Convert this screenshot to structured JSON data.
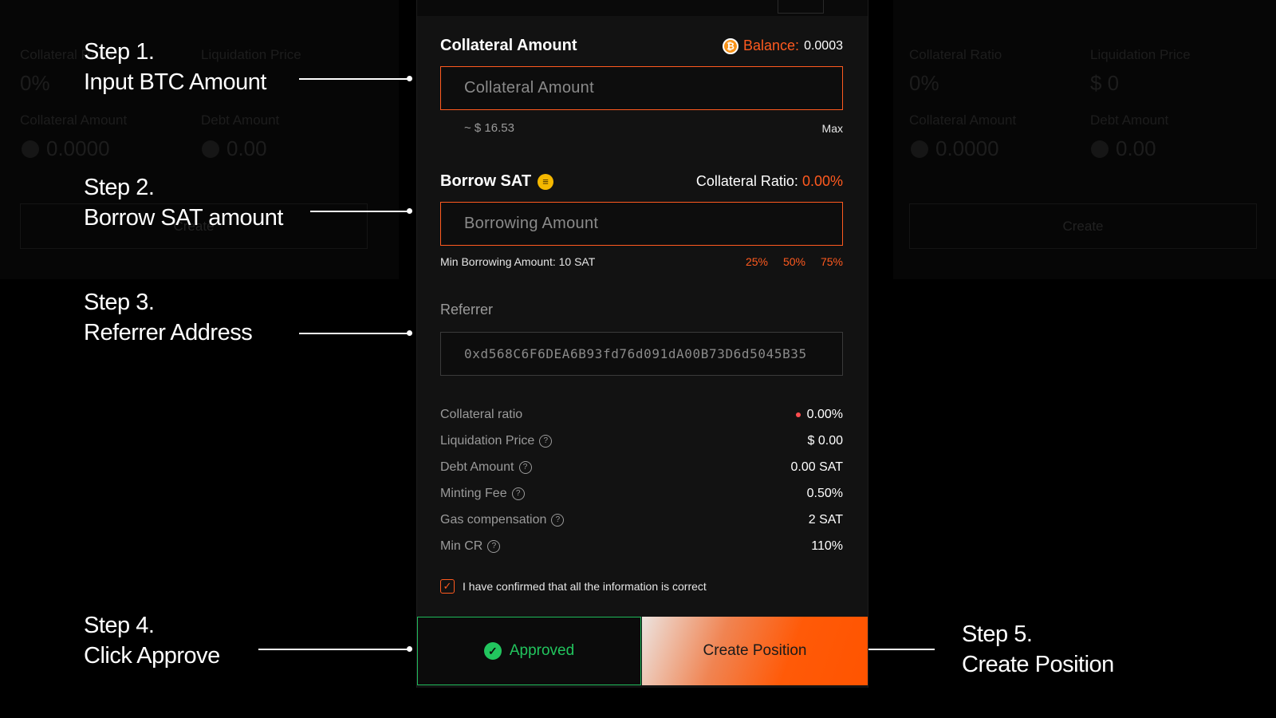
{
  "background": {
    "left_labels": [
      "Collateral Ratio",
      "Liquidation Price",
      "Collateral Amount",
      "Debt Amount"
    ],
    "left_values": [
      "0%",
      "0.0000",
      "0.00"
    ],
    "right_labels": [
      "Collateral Ratio",
      "Liquidation Price",
      "Collateral Amount",
      "Debt Amount"
    ],
    "right_values": [
      "0%",
      "$ 0",
      "0.0000",
      "0.00"
    ],
    "left_button": "Create",
    "right_button": "Create"
  },
  "steps": [
    {
      "title": "Step 1.",
      "desc": "Input BTC Amount"
    },
    {
      "title": "Step 2.",
      "desc": "Borrow SAT amount"
    },
    {
      "title": "Step 3.",
      "desc": "Referrer Address"
    },
    {
      "title": "Step 4.",
      "desc": "Click Approve"
    },
    {
      "title": "Step 5.",
      "desc": "Create Position"
    }
  ],
  "form": {
    "collateral": {
      "label": "Collateral Amount",
      "balance_label": "Balance:",
      "balance_value": "0.0003",
      "placeholder": "Collateral Amount",
      "usd_estimate": "~ $ 16.53",
      "max_label": "Max"
    },
    "borrow": {
      "label": "Borrow SAT",
      "ratio_label": "Collateral Ratio:",
      "ratio_value": "0.00%",
      "placeholder": "Borrowing Amount",
      "min_amount": "Min Borrowing Amount: 10 SAT",
      "presets": [
        "25%",
        "50%",
        "75%"
      ]
    },
    "referrer": {
      "label": "Referrer",
      "value": "0xd568C6F6DEA6B93fd76d091dA00B73D6d5045B35"
    },
    "details": [
      {
        "label": "Collateral ratio",
        "value": "0.00%"
      },
      {
        "label": "Liquidation Price",
        "value": "$ 0.00"
      },
      {
        "label": "Debt Amount",
        "value": "0.00 SAT"
      },
      {
        "label": "Minting Fee",
        "value": "0.50%"
      },
      {
        "label": "Gas compensation",
        "value": "2 SAT"
      },
      {
        "label": "Min CR",
        "value": "110%"
      }
    ],
    "confirm_text": "I have confirmed that all the information is correct",
    "approve_button": "Approved",
    "create_button": "Create Position"
  },
  "colors": {
    "accent": "#ff5a1f",
    "success": "#22c55e",
    "warning_dot": "#ff4d4f"
  }
}
